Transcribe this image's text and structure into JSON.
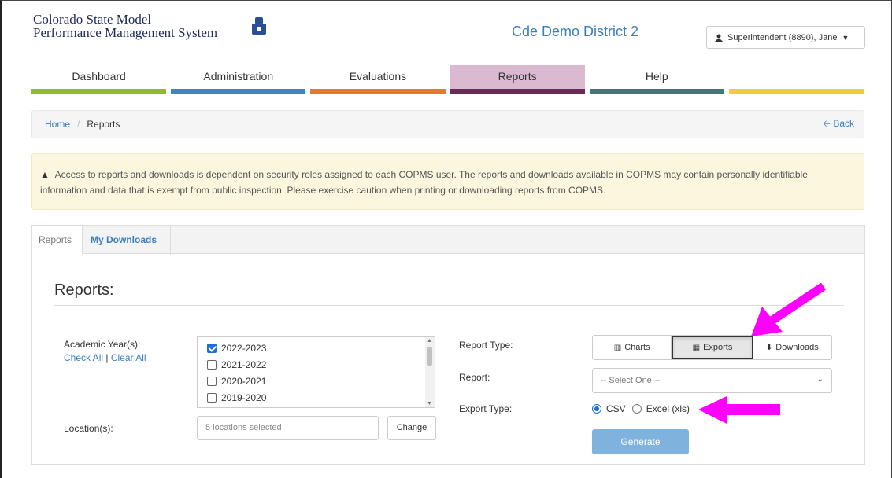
{
  "header": {
    "logo_line1": "Colorado State Model",
    "logo_line2": "Performance Management System",
    "district": "Cde Demo District 2",
    "user_label": "Superintendent (8890), Jane"
  },
  "nav": [
    {
      "label": "Dashboard",
      "color": "#8dbb2c"
    },
    {
      "label": "Administration",
      "color": "#3b86c8"
    },
    {
      "label": "Evaluations",
      "color": "#e8782a"
    },
    {
      "label": "Reports",
      "color": "#6a2a58",
      "active": true
    },
    {
      "label": "Help",
      "color": "#3c7a77"
    },
    {
      "label": "",
      "color": "#f6c842"
    }
  ],
  "breadcrumb": {
    "home": "Home",
    "current": "Reports",
    "back": "Back"
  },
  "alert": {
    "text": "Access to reports and downloads is dependent on security roles assigned to each COPMS user. The reports and downloads available in COPMS may contain personally identifiable information and data that is exempt from public inspection. Please exercise caution when printing or downloading reports from COPMS."
  },
  "tabs": {
    "reports": "Reports",
    "downloads": "My Downloads"
  },
  "form": {
    "title": "Reports:",
    "academic_label": "Academic Year(s):",
    "check_all": "Check All",
    "separator": "|",
    "clear_all": "Clear All",
    "years": [
      {
        "label": "2022-2023",
        "checked": true
      },
      {
        "label": "2021-2022",
        "checked": false
      },
      {
        "label": "2020-2021",
        "checked": false
      },
      {
        "label": "2019-2020",
        "checked": false
      }
    ],
    "location_label": "Location(s):",
    "location_value": "5 locations selected",
    "change_button": "Change",
    "report_type_label": "Report Type:",
    "report_types": {
      "charts": "Charts",
      "exports": "Exports",
      "downloads": "Downloads"
    },
    "report_label": "Report:",
    "report_placeholder": "-- Select One --",
    "export_type_label": "Export Type:",
    "export_csv": "CSV",
    "export_excel": "Excel (xls)",
    "generate_button": "Generate"
  },
  "colors": {
    "accent": "#3a7fbd",
    "annotation": "#ff00ff"
  }
}
